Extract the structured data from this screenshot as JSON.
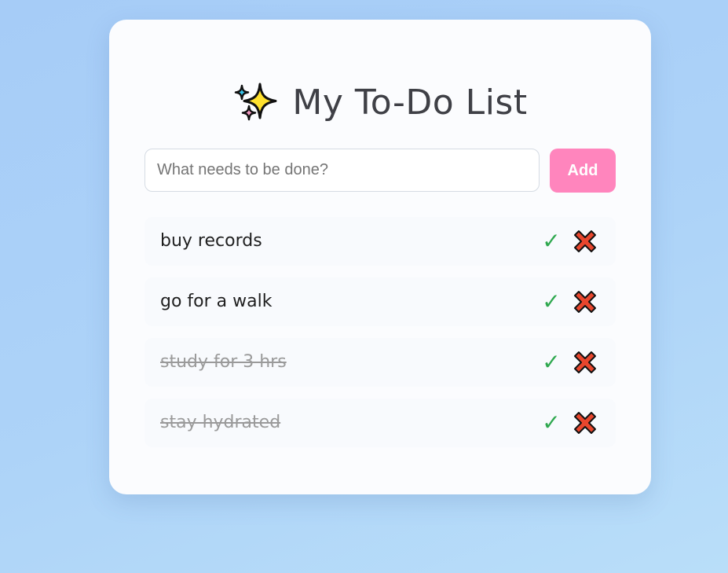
{
  "header": {
    "icon": "sparkles-icon",
    "title": "My To-Do List"
  },
  "add_form": {
    "input_value": "",
    "placeholder": "What needs to be done?",
    "add_label": "Add",
    "add_color": "#ff85bd"
  },
  "todos": [
    {
      "text": "buy records",
      "completed": false,
      "complete_icon": "✓",
      "delete_icon": "cross-mark-icon"
    },
    {
      "text": "go for a walk",
      "completed": false,
      "complete_icon": "✓",
      "delete_icon": "cross-mark-icon"
    },
    {
      "text": "study for 3 hrs",
      "completed": true,
      "complete_icon": "✓",
      "delete_icon": "cross-mark-icon"
    },
    {
      "text": "stay hydrated",
      "completed": true,
      "complete_icon": "✓",
      "delete_icon": "cross-mark-icon"
    }
  ],
  "colors": {
    "complete": "#2fa84f",
    "delete": "#e8462d",
    "completed_text": "#9a9a9a"
  }
}
